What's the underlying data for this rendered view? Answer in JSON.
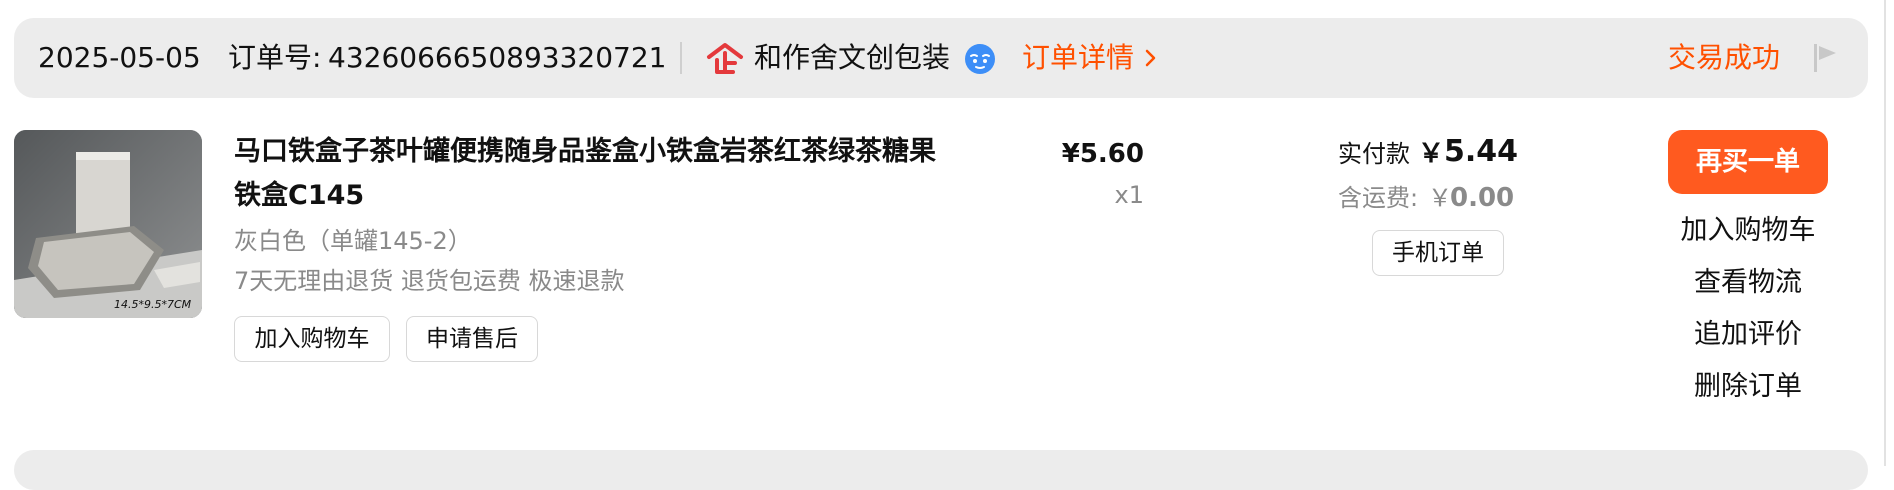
{
  "order": {
    "date": "2025-05-05",
    "order_label": "订单号:",
    "order_number": "4326066650893320721",
    "store_name": "和作舍文创包装",
    "detail_link": "订单详情",
    "status": "交易成功",
    "icons": [
      "enterprise-store-icon",
      "wangwang-chat-icon",
      "chevron-right-icon",
      "flag-icon"
    ]
  },
  "item": {
    "title": "马口铁盒子茶叶罐便携随身品鉴盒小铁盒岩茶红茶绿茶糖果铁盒C145",
    "image_caption": "14.5*9.5*7CM",
    "sku": "灰白色（单罐145-2）",
    "service": "7天无理由退货 退货包运费 极速退款",
    "add_cart_label": "加入购物车",
    "after_sale_label": "申请售后",
    "unit_price": "¥5.60",
    "quantity": "x1"
  },
  "payment": {
    "paid_label": "实付款",
    "paid_currency": "￥",
    "paid_amount": "5.44",
    "shipping_label": "含运费:",
    "shipping_currency": "￥",
    "shipping_amount": "0.00",
    "mobile_order_label": "手机订单"
  },
  "actions": {
    "rebuy": "再买一单",
    "add_cart": "加入购物车",
    "logistics": "查看物流",
    "review": "追加评价",
    "delete": "删除订单"
  },
  "colors": {
    "accent": "#ff5000",
    "button": "#ff5a1f",
    "header_bg": "#ececec",
    "muted": "#8a8a8a"
  }
}
